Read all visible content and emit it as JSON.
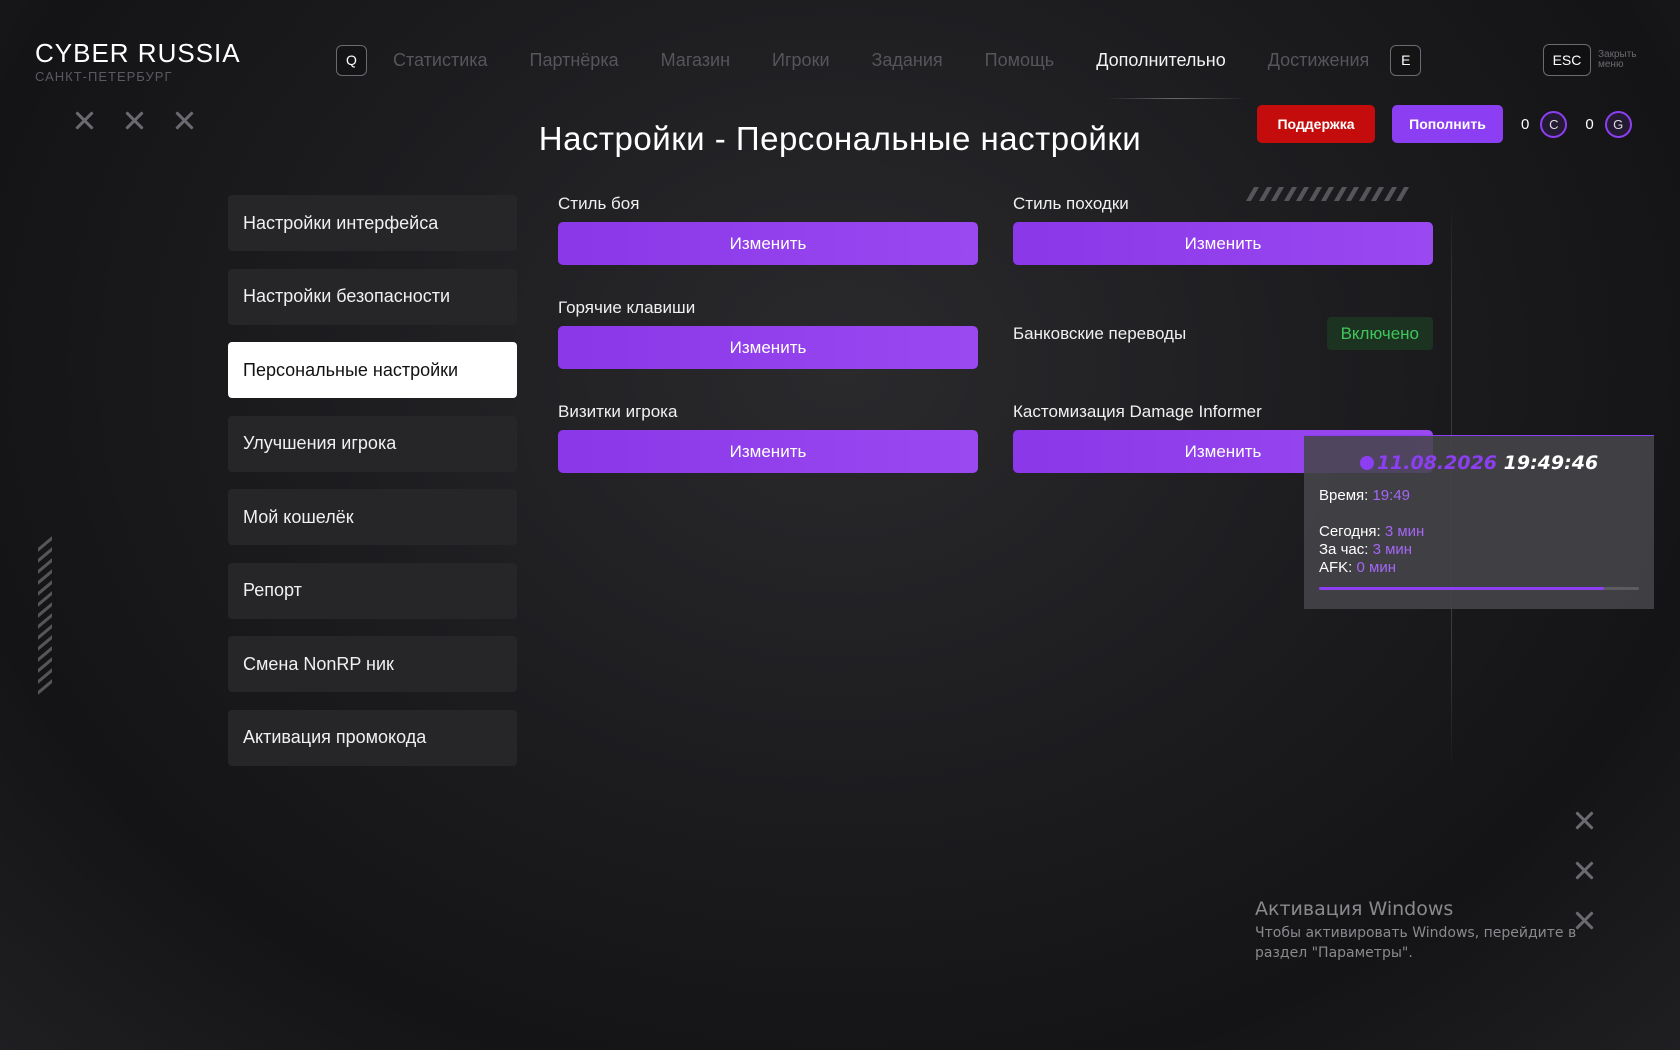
{
  "brand": {
    "title": "CYBER RUSSIA",
    "subtitle": "САНКТ-ПЕТЕРБУРГ"
  },
  "nav": {
    "left_key": "Q",
    "items": [
      "Статистика",
      "Партнёрка",
      "Магазин",
      "Игроки",
      "Задания",
      "Помощь",
      "Дополнительно",
      "Достижения"
    ],
    "active": "Дополнительно",
    "right_key": "E"
  },
  "close_menu": {
    "key": "ESC",
    "label": "Закрыть меню"
  },
  "page_title": "Настройки - Персональные настройки",
  "actions": {
    "support": "Поддержка",
    "topup": "Пополнить",
    "currency_c": {
      "value": "0",
      "icon": "C"
    },
    "currency_g": {
      "value": "0",
      "icon": "G"
    }
  },
  "sidebar": {
    "items": [
      "Настройки интерфейса",
      "Настройки безопасности",
      "Персональные настройки",
      "Улучшения игрока",
      "Мой кошелёк",
      "Репорт",
      "Смена NonRP ник",
      "Активация промокода"
    ],
    "active_index": 2
  },
  "settings": {
    "combat_style": {
      "label": "Стиль боя",
      "button": "Изменить"
    },
    "walk_style": {
      "label": "Стиль походки",
      "button": "Изменить"
    },
    "hotkeys": {
      "label": "Горячие клавиши",
      "button": "Изменить"
    },
    "bank_transfers": {
      "label": "Банковские переводы",
      "status": "Включено"
    },
    "player_cards": {
      "label": "Визитки игрока",
      "button": "Изменить"
    },
    "damage_informer": {
      "label": "Кастомизация Damage Informer",
      "button": "Изменить"
    }
  },
  "time_panel": {
    "date": "11.08.2026",
    "clock": "19:49:46",
    "time_label": "Время:",
    "time_value": "19:49",
    "today_label": "Сегодня:",
    "today_value": "3 мин",
    "hour_label": "За час:",
    "hour_value": "3 мин",
    "afk_label": "AFK:",
    "afk_value": "0 мин",
    "progress": 0.89
  },
  "windows_activation": {
    "title": "Активация Windows",
    "text": "Чтобы активировать Windows, перейдите в раздел \"Параметры\"."
  },
  "colors": {
    "accent": "#8c3ff2",
    "support": "#c50c0c",
    "enabled": "#3ec65a"
  }
}
